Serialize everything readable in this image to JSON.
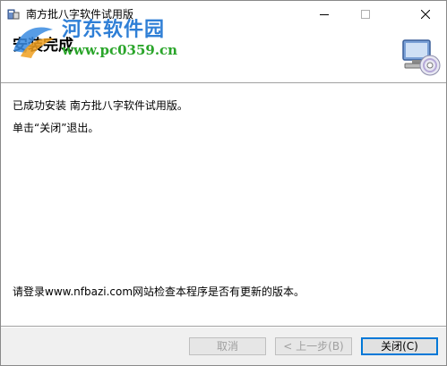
{
  "window": {
    "title": "南方批八字软件试用版"
  },
  "header": {
    "title": "安装完成"
  },
  "watermark": {
    "site_name": "河东软件园",
    "site_url": "www.pc0359.cn"
  },
  "body": {
    "line1": "已成功安装 南方批八字软件试用版。",
    "line2": "单击“关闭”退出。",
    "line3": "请登录www.nfbazi.com网站检查本程序是否有更新的版本。"
  },
  "buttons": {
    "cancel": "取消",
    "back": "< 上一步(B)",
    "close": "关闭(C)"
  },
  "colors": {
    "accent": "#0078d7",
    "watermark_blue": "#2f7fd6",
    "watermark_green": "#2aa52a"
  },
  "icons": {
    "app": "installer-icon",
    "header": "computer-cd-icon",
    "minimize": "minimize-icon",
    "maximize": "maximize-icon",
    "close": "close-icon"
  }
}
